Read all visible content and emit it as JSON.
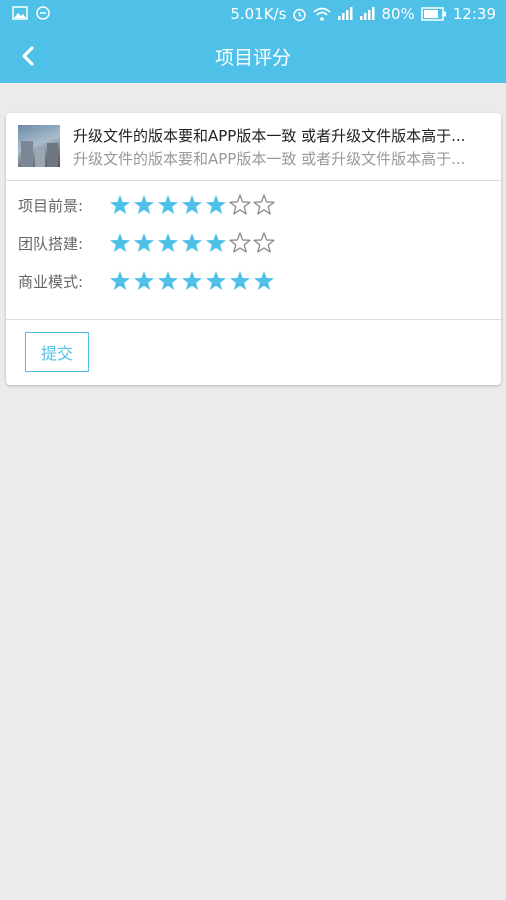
{
  "statusbar": {
    "speed": "5.01K/s",
    "battery": "80%",
    "time": "12:39",
    "icons": [
      "image-icon",
      "smiley-icon",
      "alarm-icon",
      "wifi-icon",
      "signal-icon",
      "signal-icon",
      "battery-icon"
    ]
  },
  "appbar": {
    "title": "项目评分",
    "back_icon": "chevron-left-icon"
  },
  "project": {
    "title": "升级文件的版本要和APP版本一致 或者升级文件版本高于...",
    "subtitle": "升级文件的版本要和APP版本一致 或者升级文件版本高于...",
    "thumbnail_icon": "project-thumbnail"
  },
  "ratings": [
    {
      "label": "项目前景:",
      "value": 5,
      "max": 7
    },
    {
      "label": "团队搭建:",
      "value": 5,
      "max": 7
    },
    {
      "label": "商业模式:",
      "value": 7,
      "max": 7
    }
  ],
  "submit_label": "提交",
  "colors": {
    "accent": "#4fc1e9",
    "star_filled": "#4fc1e9",
    "star_empty": "#8a8a8a",
    "background": "#ebebeb"
  }
}
